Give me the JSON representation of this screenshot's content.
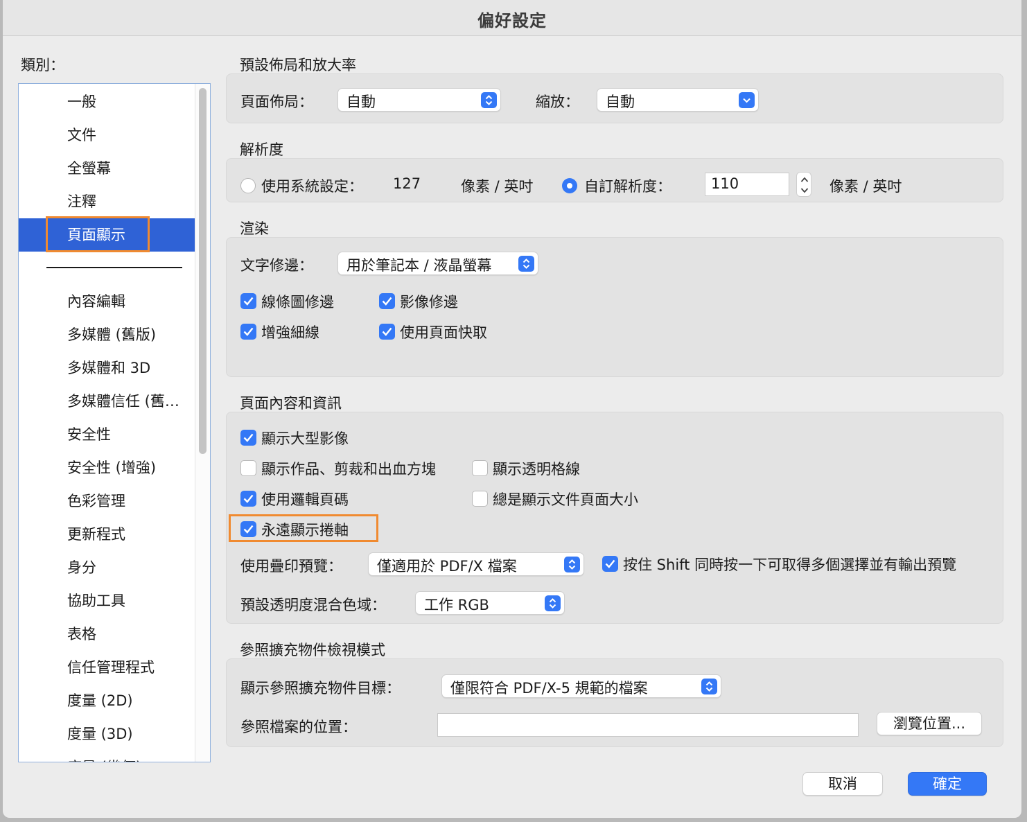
{
  "window": {
    "title": "偏好設定"
  },
  "sidebar": {
    "label": "類別：",
    "items_top": [
      {
        "label": "一般"
      },
      {
        "label": "文件"
      },
      {
        "label": "全螢幕"
      },
      {
        "label": "注釋"
      },
      {
        "label": "頁面顯示",
        "selected": true
      }
    ],
    "items_bottom": [
      {
        "label": "內容編輯"
      },
      {
        "label": "多媒體 (舊版)"
      },
      {
        "label": "多媒體和 3D"
      },
      {
        "label": "多媒體信任 (舊…"
      },
      {
        "label": "安全性"
      },
      {
        "label": "安全性 (增強)"
      },
      {
        "label": "色彩管理"
      },
      {
        "label": "更新程式"
      },
      {
        "label": "身分"
      },
      {
        "label": "協助工具"
      },
      {
        "label": "表格"
      },
      {
        "label": "信任管理程式"
      },
      {
        "label": "度量 (2D)"
      },
      {
        "label": "度量 (3D)"
      },
      {
        "label": "度量 (幾何)"
      }
    ]
  },
  "layout_zoom": {
    "title": "預設佈局和放大率",
    "page_layout_label": "頁面佈局：",
    "page_layout_value": "自動",
    "zoom_label": "縮放：",
    "zoom_value": "自動"
  },
  "resolution": {
    "title": "解析度",
    "system_label": "使用系統設定：",
    "system_value": "127",
    "system_unit": "像素 / 英吋",
    "custom_label": "自訂解析度：",
    "custom_value": "110",
    "custom_unit": "像素 / 英吋",
    "selected": "custom"
  },
  "rendering": {
    "title": "渲染",
    "smooth_text_label": "文字修邊：",
    "smooth_text_value": "用於筆記本 / 液晶螢幕",
    "checkboxes": [
      {
        "label": "線條圖修邊",
        "checked": true
      },
      {
        "label": "影像修邊",
        "checked": true
      },
      {
        "label": "增強細線",
        "checked": true
      },
      {
        "label": "使用頁面快取",
        "checked": true
      }
    ]
  },
  "page_content": {
    "title": "頁面內容和資訊",
    "checkboxes": [
      {
        "label": "顯示大型影像",
        "checked": true
      },
      {
        "label": "顯示作品、剪裁和出血方塊",
        "checked": false
      },
      {
        "label": "顯示透明格線",
        "checked": false
      },
      {
        "label": "使用邏輯頁碼",
        "checked": true
      },
      {
        "label": "總是顯示文件頁面大小",
        "checked": false
      },
      {
        "label": "永遠顯示捲軸",
        "checked": true
      }
    ],
    "overprint_label": "使用疊印預覽：",
    "overprint_value": "僅適用於 PDF/X 檔案",
    "shift_checkbox": {
      "label": "按住 Shift 同時按一下可取得多個選擇並有輸出預覽",
      "checked": true
    },
    "blend_label": "預設透明度混合色域：",
    "blend_value": "工作 RGB"
  },
  "reference_xobjects": {
    "title": "參照擴充物件檢視模式",
    "show_targets_label": "顯示參照擴充物件目標：",
    "show_targets_value": "僅限符合 PDF/X-5 規範的檔案",
    "location_label": "參照檔案的位置：",
    "location_value": "",
    "browse_button": "瀏覽位置..."
  },
  "footer": {
    "cancel": "取消",
    "ok": "確定"
  },
  "colors": {
    "accent": "#3478f6",
    "selection": "#2f62d6",
    "highlight": "#f08a30"
  }
}
